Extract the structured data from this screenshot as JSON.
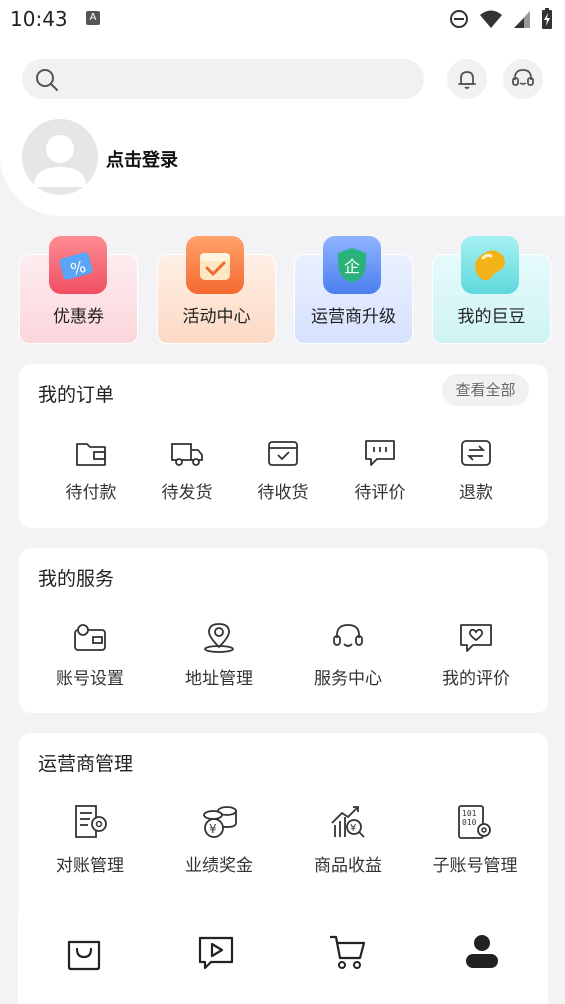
{
  "status_bar": {
    "time": "10:43",
    "a_badge": "A"
  },
  "header": {
    "search": {
      "icon": "search-icon",
      "placeholder": ""
    },
    "login_label": "点击登录"
  },
  "features": [
    {
      "label": "优惠券",
      "icon": "coupon-icon",
      "color": "#f05a6a"
    },
    {
      "label": "活动中心",
      "icon": "calendar-icon",
      "color": "#f97a45"
    },
    {
      "label": "运营商升级",
      "icon": "shield-icon",
      "color": "#3d7bf5"
    },
    {
      "label": "我的巨豆",
      "icon": "bean-icon",
      "color": "#f2b318"
    }
  ],
  "orders": {
    "title": "我的订单",
    "view_all": "查看全部",
    "items": [
      {
        "label": "待付款",
        "icon": "wallet-icon"
      },
      {
        "label": "待发货",
        "icon": "truck-icon"
      },
      {
        "label": "待收货",
        "icon": "box-check-icon"
      },
      {
        "label": "待评价",
        "icon": "comment-icon"
      },
      {
        "label": "退款",
        "icon": "refund-icon"
      }
    ]
  },
  "services": {
    "title": "我的服务",
    "items": [
      {
        "label": "账号设置",
        "icon": "account-settings-icon"
      },
      {
        "label": "地址管理",
        "icon": "location-icon"
      },
      {
        "label": "服务中心",
        "icon": "headset-icon"
      },
      {
        "label": "我的评价",
        "icon": "heart-comment-icon"
      }
    ]
  },
  "operator": {
    "title": "运营商管理",
    "items": [
      {
        "label": "对账管理",
        "icon": "reconciliation-icon"
      },
      {
        "label": "业绩奖金",
        "icon": "coins-icon"
      },
      {
        "label": "商品收益",
        "icon": "growth-chart-icon"
      },
      {
        "label": "子账号管理",
        "icon": "sub-account-icon"
      }
    ]
  },
  "bottom_nav": [
    {
      "icon": "bag-icon"
    },
    {
      "icon": "video-icon"
    },
    {
      "icon": "cart-icon"
    },
    {
      "icon": "person-icon"
    }
  ]
}
